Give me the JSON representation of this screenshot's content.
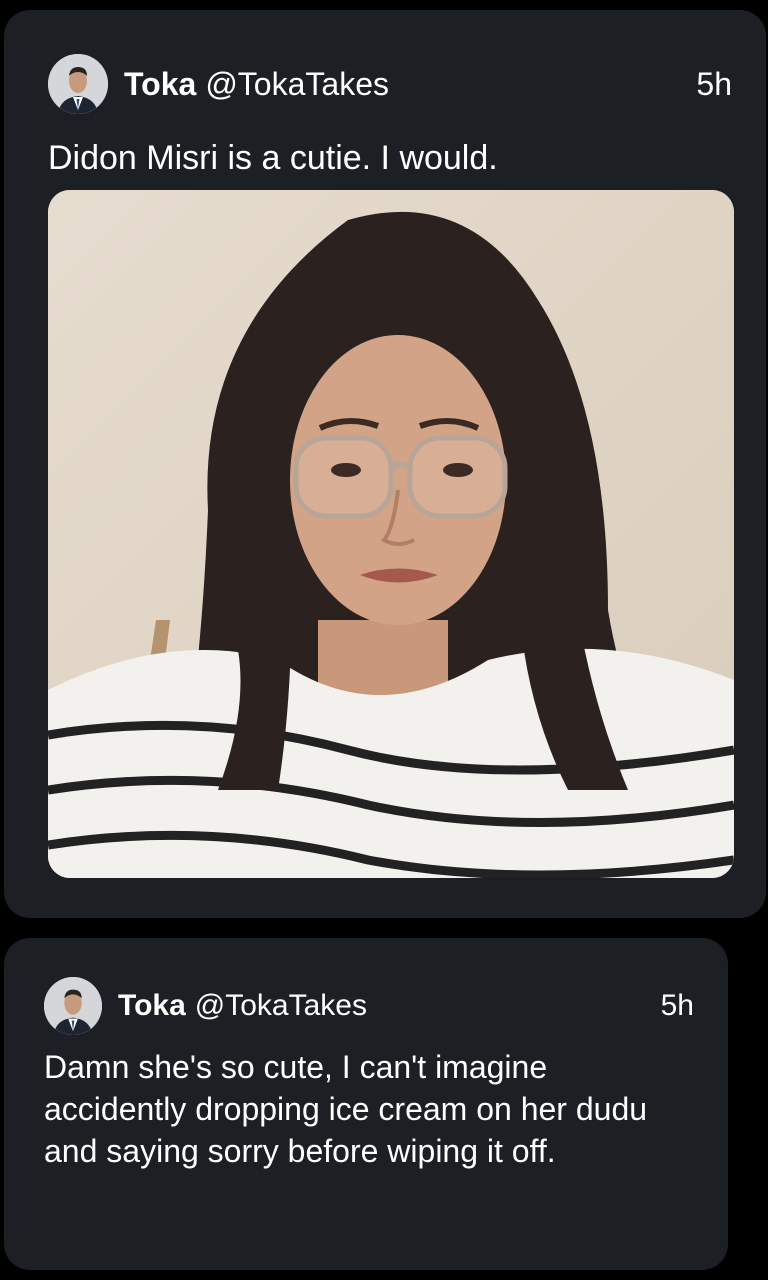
{
  "tweets": [
    {
      "author": {
        "display_name": "Toka",
        "handle": "@TokaTakes",
        "avatar_icon": "profile-avatar"
      },
      "time": "5h",
      "text": "Didon Misri is a cutie. I would.",
      "media": {
        "type": "photo",
        "icon": "photo-portrait"
      }
    },
    {
      "author": {
        "display_name": "Toka",
        "handle": "@TokaTakes",
        "avatar_icon": "profile-avatar"
      },
      "time": "5h",
      "text": "Damn she's so cute, I can't imagine accidently dropping ice cream on her dudu and saying sorry before wiping it off."
    }
  ],
  "colors": {
    "background": "#000000",
    "card": "#1c2024",
    "text": "#ffffff"
  }
}
